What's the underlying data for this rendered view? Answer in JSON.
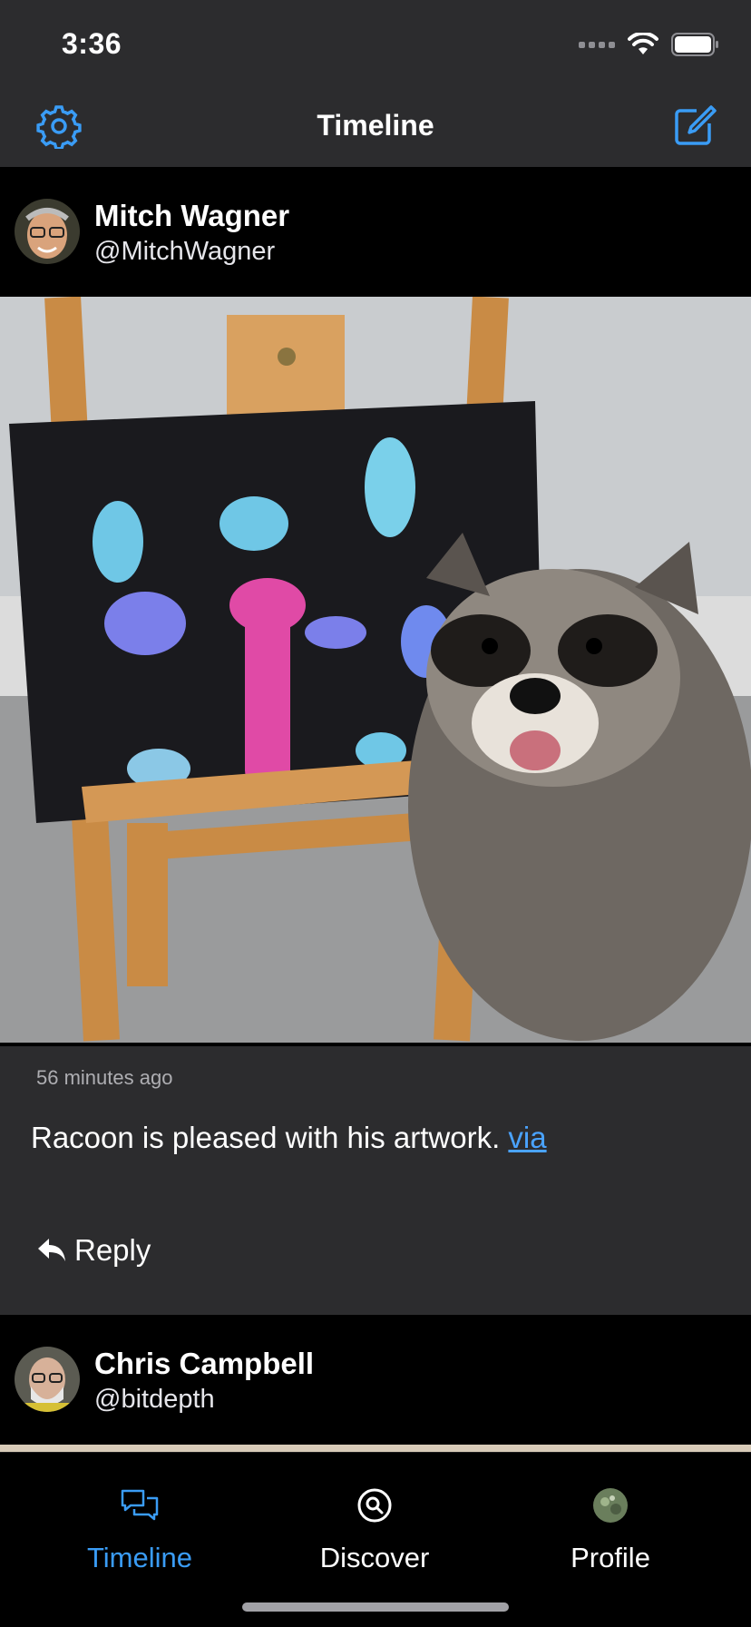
{
  "status_bar": {
    "time": "3:36"
  },
  "nav": {
    "title": "Timeline",
    "left_icon": "gear-icon",
    "right_icon": "compose-icon",
    "accent": "#3a9cf5"
  },
  "posts": [
    {
      "display_name": "Mitch Wagner",
      "handle": "@MitchWagner",
      "timestamp": "56 minutes ago",
      "text": "Racoon is pleased with his artwork. ",
      "link_text": "via",
      "reply_label": "Reply"
    },
    {
      "display_name": "Chris Campbell",
      "handle": "@bitdepth"
    }
  ],
  "tabs": [
    {
      "label": "Timeline",
      "icon": "chat-bubbles-icon",
      "active": true,
      "color": "#3a9cf5"
    },
    {
      "label": "Discover",
      "icon": "search-circle-icon",
      "active": false
    },
    {
      "label": "Profile",
      "icon": "avatar-icon",
      "active": false
    }
  ]
}
